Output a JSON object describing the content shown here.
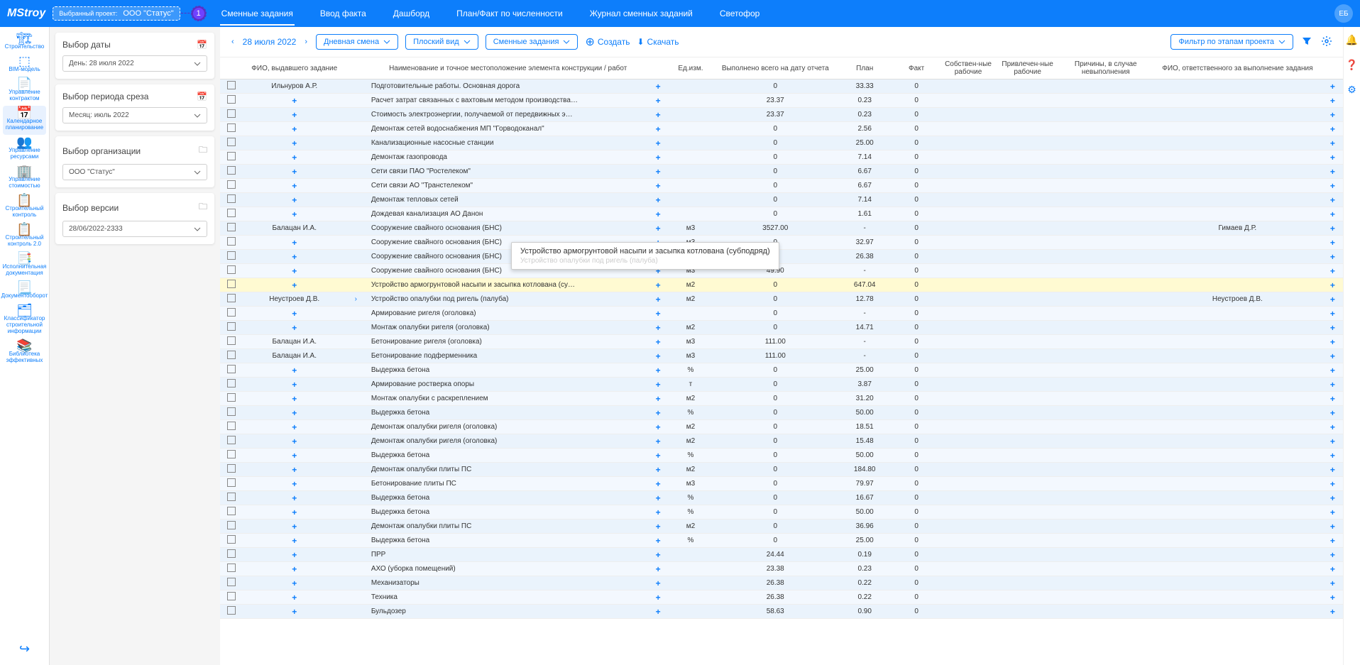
{
  "header": {
    "logo": "MStroy",
    "project_label": "Выбранный проект:",
    "project_value": "ООО \"Статус\"",
    "annot": "1",
    "tabs": [
      "Сменные задания",
      "Ввод факта",
      "Дашборд",
      "План/Факт по численности",
      "Журнал сменных заданий",
      "Светофор"
    ],
    "active_tab": 0,
    "avatar": "ЕБ"
  },
  "sidebar": [
    {
      "icon_name": "crane-icon",
      "icon": "🏗",
      "label": "Строительство"
    },
    {
      "icon_name": "cube-icon",
      "icon": "⬚",
      "label": "BIM-модель"
    },
    {
      "icon_name": "doc-icon",
      "icon": "📄",
      "label": "Управление контрактом"
    },
    {
      "icon_name": "calendar-icon",
      "icon": "📅",
      "label": "Календарное планирование",
      "active": true
    },
    {
      "icon_name": "people-icon",
      "icon": "👥",
      "label": "Управление ресурсами"
    },
    {
      "icon_name": "building-icon",
      "icon": "🏢",
      "label": "Управление стоимостью"
    },
    {
      "icon_name": "check-doc-icon",
      "icon": "📋",
      "label": "Строительный контроль"
    },
    {
      "icon_name": "check-doc2-icon",
      "icon": "📋",
      "label": "Строительный контроль 2.0"
    },
    {
      "icon_name": "exec-doc-icon",
      "icon": "📑",
      "label": "Исполнительная документация"
    },
    {
      "icon_name": "flow-doc-icon",
      "icon": "📃",
      "label": "Документооборот"
    },
    {
      "icon_name": "classifier-icon",
      "icon": "🗂",
      "label": "Классификатор строительной информации"
    },
    {
      "icon_name": "library-icon",
      "icon": "📚",
      "label": "Библиотека эффективных"
    }
  ],
  "sidebar_logout": {
    "icon_name": "logout-icon",
    "icon": "↪"
  },
  "filters": {
    "date": {
      "title": "Выбор даты",
      "value": "День: 28 июля 2022"
    },
    "period": {
      "title": "Выбор периода среза",
      "value": "Месяц: июль 2022"
    },
    "org": {
      "title": "Выбор организации",
      "value": "ООО \"Статус\""
    },
    "version": {
      "title": "Выбор версии",
      "value": "28/06/2022-2333"
    }
  },
  "toolbar": {
    "date": "28 июля 2022",
    "shift": "Дневная смена",
    "view": "Плоский вид",
    "type": "Сменные задания",
    "create": "Создать",
    "download": "Скачать",
    "stage_filter": "Фильтр по этапам проекта"
  },
  "columns": [
    "",
    "ФИО, выдавшего задание",
    "",
    "Наименование и точное местоположение элемента конструкции / работ",
    "",
    "Ед.изм.",
    "Выполнено всего на дату отчета",
    "План",
    "Факт",
    "Собствен-ные рабочие",
    "Привлечен-ные рабочие",
    "Причины, в случае невыполнения",
    "ФИО, ответственного за выполнение задания",
    ""
  ],
  "rows": [
    {
      "issuer": "Ильнуров А.Р.",
      "name": "Подготовительные работы. Основная дорога",
      "unit": "",
      "done": "0",
      "plan": "33.33",
      "fact": "0",
      "alt": true
    },
    {
      "issuer": "",
      "expand": true,
      "name": "Расчет затрат связанных с вахтовым методом производства…",
      "unit": "",
      "done": "23.37",
      "plan": "0.23",
      "fact": "0"
    },
    {
      "issuer": "",
      "expand": true,
      "name": "Стоимость электроэнергии, получаемой от передвижных э…",
      "unit": "",
      "done": "23.37",
      "plan": "0.23",
      "fact": "0",
      "alt": true
    },
    {
      "issuer": "",
      "expand": true,
      "name": "Демонтаж сетей водоснабжения МП \"Горводоканал\"",
      "unit": "",
      "done": "0",
      "plan": "2.56",
      "fact": "0"
    },
    {
      "issuer": "",
      "expand": true,
      "name": "Канализационные насосные станции",
      "unit": "",
      "done": "0",
      "plan": "25.00",
      "fact": "0",
      "alt": true
    },
    {
      "issuer": "",
      "expand": true,
      "name": "Демонтаж газопровода",
      "unit": "",
      "done": "0",
      "plan": "7.14",
      "fact": "0"
    },
    {
      "issuer": "",
      "expand": true,
      "name": "Сети связи ПАО \"Ростелеком\"",
      "unit": "",
      "done": "0",
      "plan": "6.67",
      "fact": "0",
      "alt": true
    },
    {
      "issuer": "",
      "expand": true,
      "name": "Сети связи АО \"Транстелеком\"",
      "unit": "",
      "done": "0",
      "plan": "6.67",
      "fact": "0"
    },
    {
      "issuer": "",
      "expand": true,
      "name": "Демонтаж тепловых сетей",
      "unit": "",
      "done": "0",
      "plan": "7.14",
      "fact": "0",
      "alt": true
    },
    {
      "issuer": "",
      "expand": true,
      "name": "Дождевая канализация АО Данон",
      "unit": "",
      "done": "0",
      "plan": "1.61",
      "fact": "0"
    },
    {
      "issuer": "Балацан И.А.",
      "name": "Сооружение свайного основания (БНС)",
      "unit": "м3",
      "done": "3527.00",
      "plan": "-",
      "fact": "0",
      "resp": "Гимаев Д.Р.",
      "alt": true
    },
    {
      "issuer": "",
      "expand": true,
      "name": "Сооружение свайного основания (БНС)",
      "unit": "м3",
      "done": "0",
      "plan": "32.97",
      "fact": "0"
    },
    {
      "issuer": "",
      "expand": true,
      "name": "Сооружение свайного основания (БНС)",
      "unit": "м3",
      "done": "0",
      "plan": "26.38",
      "fact": "0",
      "alt": true
    },
    {
      "issuer": "",
      "expand": true,
      "name": "Сооружение свайного основания (БНС)",
      "unit": "м3",
      "done": "49.90",
      "plan": "-",
      "fact": "0"
    },
    {
      "issuer": "",
      "expand": true,
      "name": "Устройство армогрунтовой насыпи и засыпка котлована (су…",
      "unit": "м2",
      "done": "0",
      "plan": "647.04",
      "fact": "0",
      "hi": true
    },
    {
      "issuer": "Неустроев Д.В.",
      "arrow": true,
      "name": "Устройство опалубки под ригель (палуба)",
      "unit": "м2",
      "done": "0",
      "plan": "12.78",
      "fact": "0",
      "resp": "Неустроев Д.В.",
      "alt": true
    },
    {
      "issuer": "",
      "expand": true,
      "name": "Армирование ригеля (оголовка)",
      "unit": "",
      "done": "0",
      "plan": "-",
      "fact": "0"
    },
    {
      "issuer": "",
      "expand": true,
      "name": "Монтаж опалубки ригеля (оголовка)",
      "unit": "м2",
      "done": "0",
      "plan": "14.71",
      "fact": "0",
      "alt": true
    },
    {
      "issuer": "Балацан И.А.",
      "name": "Бетонирование ригеля (оголовка)",
      "unit": "м3",
      "done": "111.00",
      "plan": "-",
      "fact": "0"
    },
    {
      "issuer": "Балацан И.А.",
      "name": "Бетонирование подферменника",
      "unit": "м3",
      "done": "111.00",
      "plan": "-",
      "fact": "0",
      "alt": true
    },
    {
      "issuer": "",
      "expand": true,
      "name": "Выдержка бетона",
      "unit": "%",
      "done": "0",
      "plan": "25.00",
      "fact": "0"
    },
    {
      "issuer": "",
      "expand": true,
      "name": "Армирование ростверка опоры",
      "unit": "т",
      "done": "0",
      "plan": "3.87",
      "fact": "0",
      "alt": true
    },
    {
      "issuer": "",
      "expand": true,
      "name": "Монтаж опалубки с раскреплением",
      "unit": "м2",
      "done": "0",
      "plan": "31.20",
      "fact": "0"
    },
    {
      "issuer": "",
      "expand": true,
      "name": "Выдержка бетона",
      "unit": "%",
      "done": "0",
      "plan": "50.00",
      "fact": "0",
      "alt": true
    },
    {
      "issuer": "",
      "expand": true,
      "name": "Демонтаж опалубки ригеля (оголовка)",
      "unit": "м2",
      "done": "0",
      "plan": "18.51",
      "fact": "0"
    },
    {
      "issuer": "",
      "expand": true,
      "name": "Демонтаж опалубки ригеля (оголовка)",
      "unit": "м2",
      "done": "0",
      "plan": "15.48",
      "fact": "0",
      "alt": true
    },
    {
      "issuer": "",
      "expand": true,
      "name": "Выдержка бетона",
      "unit": "%",
      "done": "0",
      "plan": "50.00",
      "fact": "0"
    },
    {
      "issuer": "",
      "expand": true,
      "name": "Демонтаж опалубки плиты ПС",
      "unit": "м2",
      "done": "0",
      "plan": "184.80",
      "fact": "0",
      "alt": true
    },
    {
      "issuer": "",
      "expand": true,
      "name": "Бетонирование плиты ПС",
      "unit": "м3",
      "done": "0",
      "plan": "79.97",
      "fact": "0"
    },
    {
      "issuer": "",
      "expand": true,
      "name": "Выдержка бетона",
      "unit": "%",
      "done": "0",
      "plan": "16.67",
      "fact": "0",
      "alt": true
    },
    {
      "issuer": "",
      "expand": true,
      "name": "Выдержка бетона",
      "unit": "%",
      "done": "0",
      "plan": "50.00",
      "fact": "0"
    },
    {
      "issuer": "",
      "expand": true,
      "name": "Демонтаж опалубки плиты ПС",
      "unit": "м2",
      "done": "0",
      "plan": "36.96",
      "fact": "0",
      "alt": true
    },
    {
      "issuer": "",
      "expand": true,
      "name": "Выдержка бетона",
      "unit": "%",
      "done": "0",
      "plan": "25.00",
      "fact": "0"
    },
    {
      "issuer": "",
      "expand": true,
      "name": "ПРР",
      "unit": "",
      "done": "24.44",
      "plan": "0.19",
      "fact": "0",
      "alt": true
    },
    {
      "issuer": "",
      "expand": true,
      "name": "АХО (уборка помещений)",
      "unit": "",
      "done": "23.38",
      "plan": "0.23",
      "fact": "0"
    },
    {
      "issuer": "",
      "expand": true,
      "name": "Механизаторы",
      "unit": "",
      "done": "26.38",
      "plan": "0.22",
      "fact": "0",
      "alt": true
    },
    {
      "issuer": "",
      "expand": true,
      "name": "Техника",
      "unit": "",
      "done": "26.38",
      "plan": "0.22",
      "fact": "0"
    },
    {
      "issuer": "",
      "expand": true,
      "name": "Бульдозер",
      "unit": "",
      "done": "58.63",
      "plan": "0.90",
      "fact": "0",
      "alt": true
    }
  ],
  "tooltip": {
    "line1": "Устройство армогрунтовой насыпи и засыпка котлована (субподряд)",
    "line2": "Устройство опалубки под ригель (палуба)"
  }
}
